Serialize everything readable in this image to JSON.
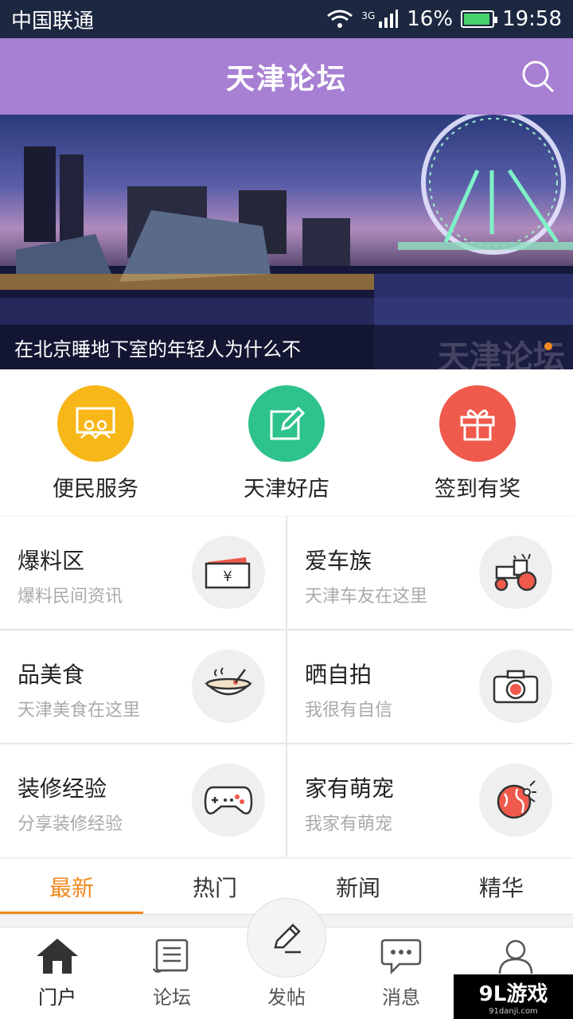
{
  "status_bar": {
    "carrier": "中国联通",
    "network": "3G",
    "battery": "16%",
    "time": "19:58"
  },
  "header": {
    "title": "天津论坛",
    "search_icon": "search-icon"
  },
  "banner": {
    "caption": "在北京睡地下室的年轻人为什么不",
    "watermark_text": "天津论坛"
  },
  "quick_actions": [
    {
      "label": "便民服务",
      "color": "#f7b718",
      "icon": "people-board-icon"
    },
    {
      "label": "天津好店",
      "color": "#2ec28c",
      "icon": "edit-icon"
    },
    {
      "label": "签到有奖",
      "color": "#ef5a4c",
      "icon": "gift-icon"
    }
  ],
  "categories": [
    {
      "title": "爆料区",
      "subtitle": "爆料民间资讯",
      "icon": "money-envelope-icon"
    },
    {
      "title": "爱车族",
      "subtitle": "天津车友在这里",
      "icon": "tractor-icon"
    },
    {
      "title": "品美食",
      "subtitle": "天津美食在这里",
      "icon": "bowl-icon"
    },
    {
      "title": "晒自拍",
      "subtitle": "我很有自信",
      "icon": "camera-icon"
    },
    {
      "title": "装修经验",
      "subtitle": "分享装修经验",
      "icon": "gamepad-icon"
    },
    {
      "title": "家有萌宠",
      "subtitle": "我家有萌宠",
      "icon": "pet-ball-icon"
    }
  ],
  "tabs": [
    {
      "label": "最新",
      "active": true
    },
    {
      "label": "热门",
      "active": false
    },
    {
      "label": "新闻",
      "active": false
    },
    {
      "label": "精华",
      "active": false
    }
  ],
  "bottom_nav": [
    {
      "label": "门户",
      "icon": "home-icon",
      "active": true
    },
    {
      "label": "论坛",
      "icon": "scroll-icon",
      "active": false
    },
    {
      "label": "发帖",
      "icon": "pen-icon",
      "active": false
    },
    {
      "label": "消息",
      "icon": "chat-icon",
      "active": false
    },
    {
      "label": "我的",
      "icon": "user-icon",
      "active": false
    }
  ],
  "watermark": {
    "brand": "9L游戏",
    "site": "91danji.com"
  },
  "colors": {
    "header": "#a77fd3",
    "accent": "#f08a20"
  }
}
